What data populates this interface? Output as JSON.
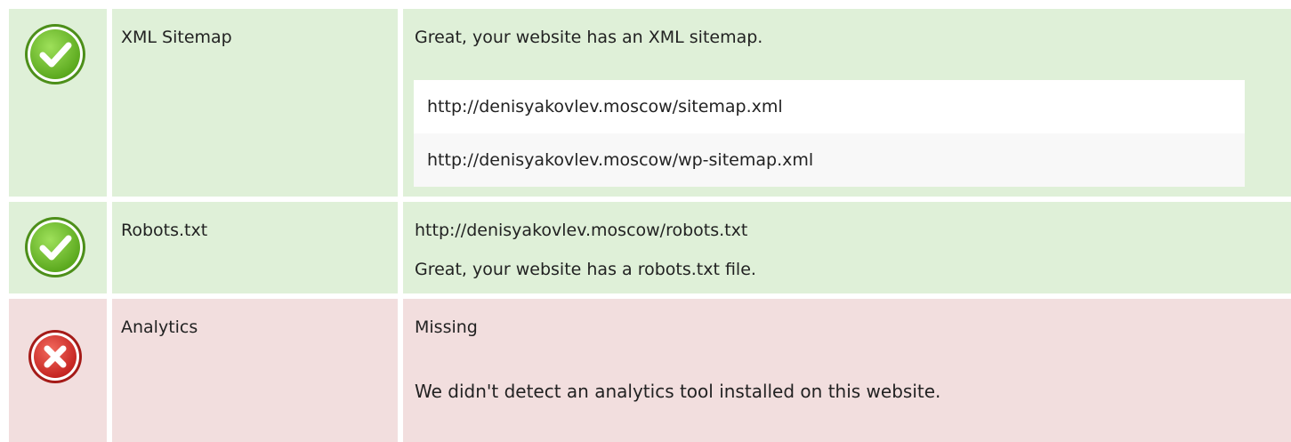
{
  "colors": {
    "pass_row": "#dff0d8",
    "fail_row": "#f2dede",
    "pass_icon": "#6fbf27",
    "fail_icon": "#d9312f"
  },
  "rows": [
    {
      "status": "pass",
      "icon": "check-circle-icon",
      "name": "XML Sitemap",
      "message": "Great, your website has an XML sitemap.",
      "urls": [
        "http://denisyakovlev.moscow/sitemap.xml",
        "http://denisyakovlev.moscow/wp-sitemap.xml"
      ]
    },
    {
      "status": "pass",
      "icon": "check-circle-icon",
      "name": "Robots.txt",
      "url": "http://denisyakovlev.moscow/robots.txt",
      "message": "Great, your website has a robots.txt file."
    },
    {
      "status": "fail",
      "icon": "x-circle-icon",
      "name": "Analytics",
      "result": "Missing",
      "message": "We didn't detect an analytics tool installed on this website."
    }
  ]
}
